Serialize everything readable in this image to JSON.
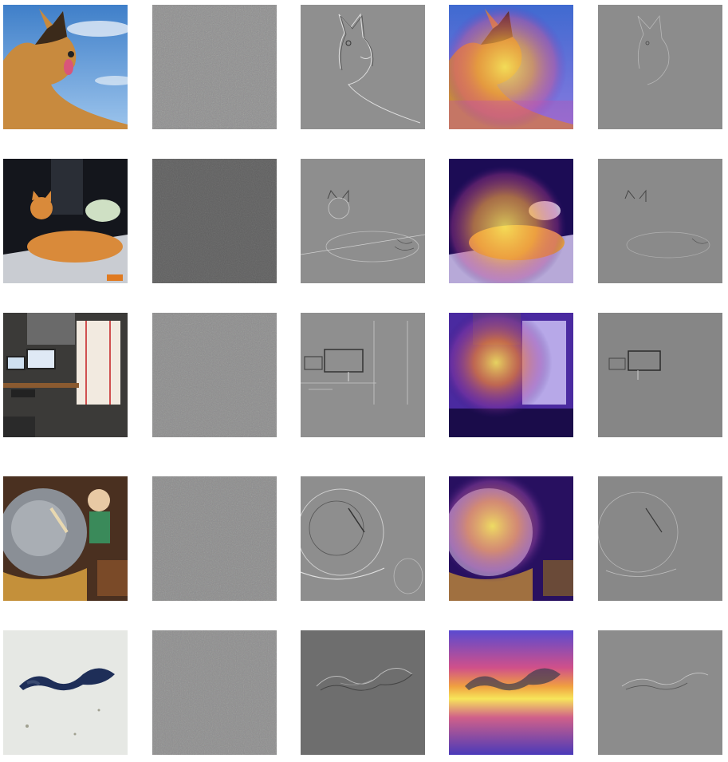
{
  "grid": {
    "rows": [
      {
        "subject": "dog",
        "panels": [
          "original-image",
          "gradient-noise-map",
          "guided-backprop-edges",
          "gradcam-heatmap-overlay",
          "guided-gradcam-edges"
        ]
      },
      {
        "subject": "cat",
        "panels": [
          "original-image",
          "gradient-noise-map",
          "guided-backprop-edges",
          "gradcam-heatmap-overlay",
          "guided-gradcam-edges"
        ]
      },
      {
        "subject": "desk",
        "panels": [
          "original-image",
          "gradient-noise-map",
          "guided-backprop-edges",
          "gradcam-heatmap-overlay",
          "guided-gradcam-edges"
        ]
      },
      {
        "subject": "steel-drum",
        "panels": [
          "original-image",
          "gradient-noise-map",
          "guided-backprop-edges",
          "gradcam-heatmap-overlay",
          "guided-gradcam-edges"
        ]
      },
      {
        "subject": "snake",
        "panels": [
          "original-image",
          "gradient-noise-map",
          "guided-backprop-edges",
          "gradcam-heatmap-overlay",
          "guided-gradcam-edges"
        ]
      }
    ],
    "colors": {
      "gray_panel": "#8a8a8a",
      "dark_gray_panel": "#5c5c5c",
      "heat_hot": "#f7e55a",
      "heat_mid": "#e0508a",
      "heat_cold": "#2a0f6e"
    }
  }
}
